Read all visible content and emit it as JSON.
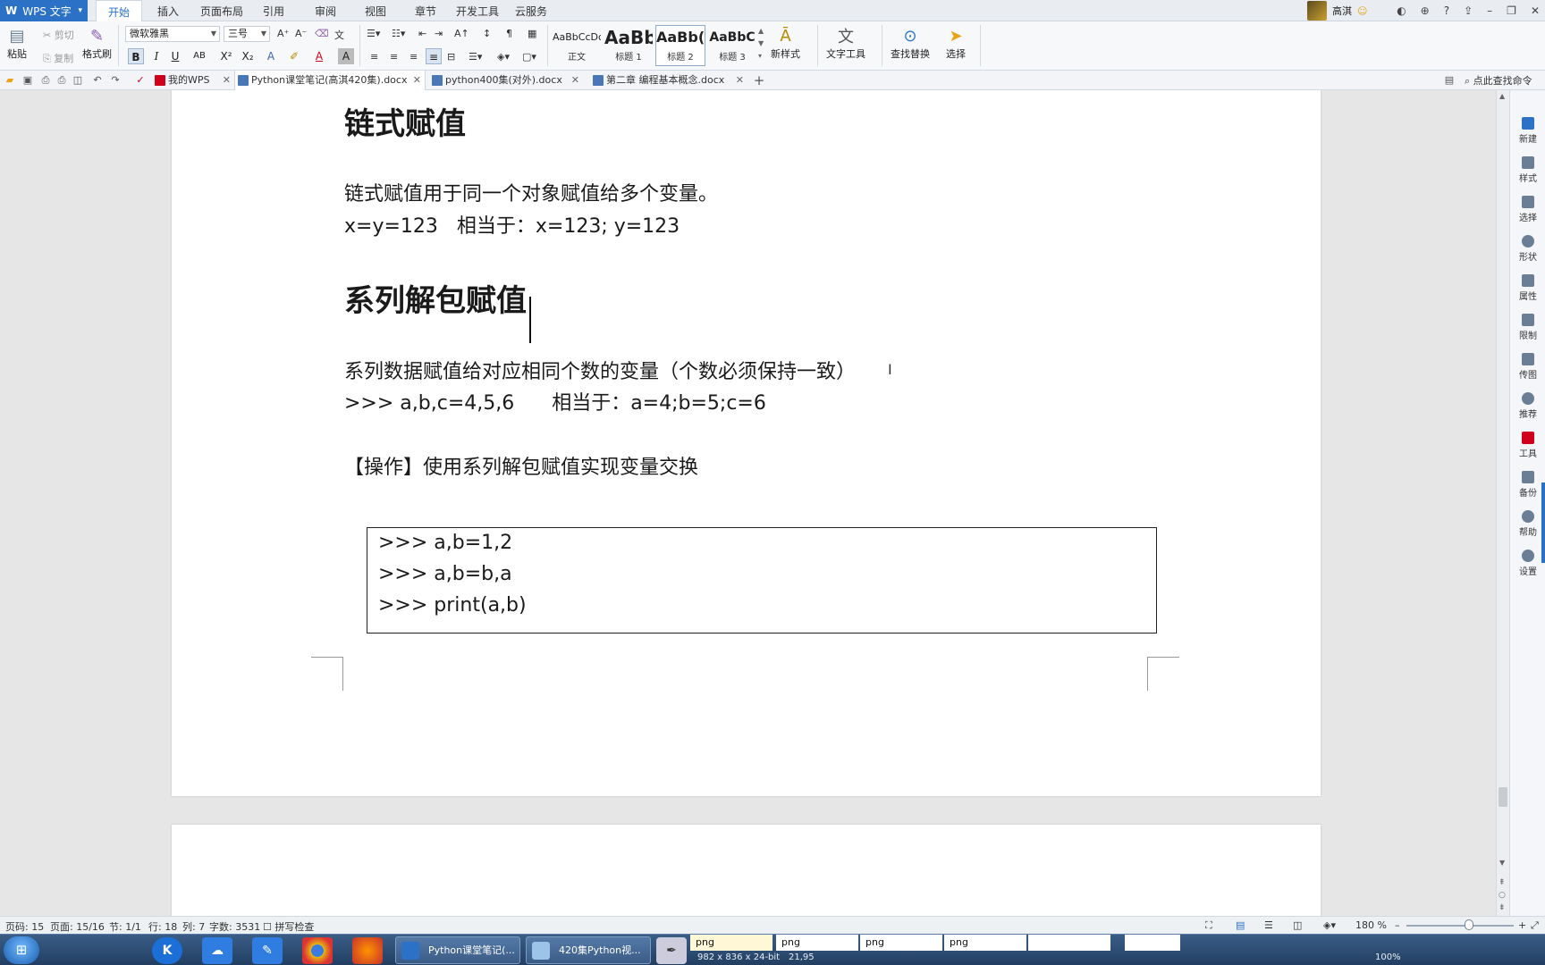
{
  "app": {
    "name": "WPS 文字"
  },
  "menu_tabs": [
    "开始",
    "插入",
    "页面布局",
    "引用",
    "审阅",
    "视图",
    "章节",
    "开发工具",
    "云服务"
  ],
  "user": {
    "name": "高淇"
  },
  "ribbon": {
    "paste": "粘贴",
    "cut": "剪切",
    "copy": "复制",
    "format_painter": "格式刷",
    "font_name": "微软雅黑",
    "font_size": "三号",
    "styles": [
      {
        "preview": "AaBbCcDd",
        "name": "正文"
      },
      {
        "preview": "AaBb",
        "name": "标题 1"
      },
      {
        "preview": "AaBb(",
        "name": "标题 2"
      },
      {
        "preview": "AaBbC",
        "name": "标题 3"
      }
    ],
    "new_style": "新样式",
    "text_tools": "文字工具",
    "find_replace": "查找替换",
    "select": "选择"
  },
  "doc_tabs": [
    {
      "label": "我的WPS"
    },
    {
      "label": "Python课堂笔记(高淇420集).docx"
    },
    {
      "label": "python400集(对外).docx"
    },
    {
      "label": "第二章 编程基本概念.docx"
    }
  ],
  "search_cmd": "点此查找命令",
  "document": {
    "heading1": "链式赋值",
    "para1": "链式赋值用于同一个对象赋值给多个变量。",
    "para2": "x=y=123   相当于：x=123; y=123",
    "heading2": "系列解包赋值",
    "para3": "系列数据赋值给对应相同个数的变量（个数必须保持一致）",
    "para4": ">>> a,b,c=4,5,6      相当于：a=4;b=5;c=6",
    "para5": "【操作】使用系列解包赋值实现变量交换",
    "code": [
      ">>> a,b=1,2",
      ">>> a,b=b,a",
      ">>> print(a,b)"
    ]
  },
  "sidebar": [
    "新建",
    "样式",
    "选择",
    "形状",
    "属性",
    "限制",
    "传图",
    "推荐",
    "工具",
    "备份",
    "帮助",
    "设置"
  ],
  "status": {
    "page_code": "页码: 15",
    "page": "页面: 15/16",
    "section": "节: 1/1",
    "row": "行: 18",
    "col": "列: 7",
    "words": "字数: 3531",
    "spell": "拼写检查",
    "zoom": "180 %"
  },
  "taskbar": {
    "windows": [
      "Python课堂笔记(...",
      "420集Python视..."
    ],
    "thumbs": [
      "png",
      "png",
      "png",
      "png"
    ],
    "info": [
      "982 x 836 x 24-bit",
      "21,95",
      "100%"
    ]
  },
  "colors": {
    "accent": "#2b72c6",
    "text": "#1a1a1a"
  }
}
